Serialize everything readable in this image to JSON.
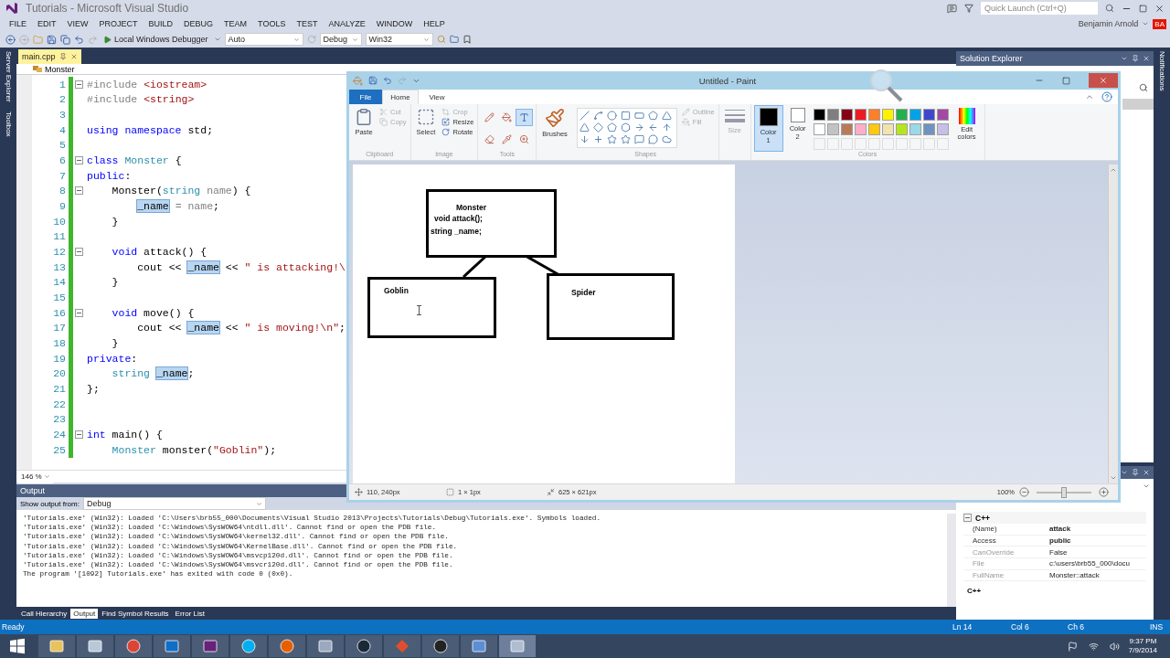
{
  "vs": {
    "title": "Tutorials - Microsoft Visual Studio",
    "quick_launch": {
      "placeholder": "Quick Launch (Ctrl+Q)"
    },
    "user": "Benjamin Arnold",
    "user_initials": "BA",
    "menu": [
      "FILE",
      "EDIT",
      "VIEW",
      "PROJECT",
      "BUILD",
      "DEBUG",
      "TEAM",
      "TOOLS",
      "TEST",
      "ANALYZE",
      "WINDOW",
      "HELP"
    ],
    "toolbar": {
      "debugger": "Local Windows Debugger",
      "target": "Auto",
      "configuration": "Debug",
      "platform": "Win32"
    },
    "side_tabs": [
      "Server Explorer",
      "Toolbox"
    ],
    "notifications_tab": "Notifications",
    "editor": {
      "tab": "main.cpp",
      "scope": "Monster",
      "zoom": "146 %",
      "lines": [
        {
          "number": "1",
          "fold": true,
          "tokens": [
            {
              "kind": "pre",
              "text": "#include "
            },
            {
              "kind": "str",
              "text": "<iostream>"
            }
          ]
        },
        {
          "number": "2",
          "fold": false,
          "tokens": [
            {
              "kind": "pre",
              "text": "#include "
            },
            {
              "kind": "str",
              "text": "<string>"
            }
          ]
        },
        {
          "number": "3",
          "fold": false
        },
        {
          "number": "4",
          "fold": false,
          "tokens": [
            {
              "kind": "kw",
              "text": "using namespace"
            },
            {
              "kind": "plain",
              "text": " std;"
            }
          ]
        },
        {
          "number": "5",
          "fold": false
        },
        {
          "number": "6",
          "fold": true,
          "tokens": [
            {
              "kind": "kw",
              "text": "class "
            },
            {
              "kind": "type",
              "text": "Monster"
            },
            {
              "kind": "plain",
              "text": " {"
            }
          ]
        },
        {
          "number": "7",
          "fold": false,
          "tokens": [
            {
              "kind": "kw",
              "text": "public"
            },
            {
              "kind": "plain",
              "text": ":"
            }
          ]
        },
        {
          "number": "8",
          "fold": true,
          "tokens": [
            {
              "kind": "plain",
              "text": "    Monster("
            },
            {
              "kind": "type",
              "text": "string"
            },
            {
              "kind": "param",
              "text": " name"
            },
            {
              "kind": "plain",
              "text": ") {"
            }
          ]
        },
        {
          "number": "9",
          "fold": false,
          "tokens": [
            {
              "kind": "ref",
              "text": "        _name"
            },
            {
              "kind": "param",
              "text": " = name"
            },
            {
              "kind": "plain",
              "text": ";"
            }
          ]
        },
        {
          "number": "10",
          "fold": false,
          "tokens": [
            {
              "kind": "plain",
              "text": "    }"
            }
          ]
        },
        {
          "number": "11",
          "fold": false
        },
        {
          "number": "12",
          "fold": true,
          "tokens": [
            {
              "kind": "kw",
              "text": "    void"
            },
            {
              "kind": "plain",
              "text": " attack() {"
            }
          ]
        },
        {
          "number": "13",
          "fold": false,
          "tokens": [
            {
              "kind": "plain",
              "text": "        cout << "
            },
            {
              "kind": "ref",
              "text": "_name"
            },
            {
              "kind": "plain",
              "text": " << "
            },
            {
              "kind": "str",
              "text": "\" is attacking!\\"
            }
          ]
        },
        {
          "number": "14",
          "fold": false,
          "tokens": [
            {
              "kind": "plain",
              "text": "    }"
            }
          ]
        },
        {
          "number": "15",
          "fold": false
        },
        {
          "number": "16",
          "fold": true,
          "tokens": [
            {
              "kind": "kw",
              "text": "    void"
            },
            {
              "kind": "plain",
              "text": " move() {"
            }
          ]
        },
        {
          "number": "17",
          "fold": false,
          "tokens": [
            {
              "kind": "plain",
              "text": "        cout << "
            },
            {
              "kind": "ref",
              "text": "_name"
            },
            {
              "kind": "plain",
              "text": " << "
            },
            {
              "kind": "str",
              "text": "\" is moving!\\n\""
            },
            {
              "kind": "plain",
              "text": ";"
            }
          ]
        },
        {
          "number": "18",
          "fold": false,
          "tokens": [
            {
              "kind": "plain",
              "text": "    }"
            }
          ]
        },
        {
          "number": "19",
          "fold": false,
          "tokens": [
            {
              "kind": "kw",
              "text": "private"
            },
            {
              "kind": "plain",
              "text": ":"
            }
          ]
        },
        {
          "number": "20",
          "fold": false,
          "tokens": [
            {
              "kind": "type",
              "text": "    string"
            },
            {
              "kind": "ref",
              "text": " _name"
            },
            {
              "kind": "plain",
              "text": ";"
            }
          ]
        },
        {
          "number": "21",
          "fold": false,
          "tokens": [
            {
              "kind": "plain",
              "text": "};"
            }
          ]
        },
        {
          "number": "22",
          "fold": false
        },
        {
          "number": "23",
          "fold": false
        },
        {
          "number": "24",
          "fold": true,
          "tokens": [
            {
              "kind": "kw",
              "text": "int"
            },
            {
              "kind": "plain",
              "text": " main() {"
            }
          ]
        },
        {
          "number": "25",
          "fold": false,
          "tokens": [
            {
              "kind": "type",
              "text": "    Monster"
            },
            {
              "kind": "plain",
              "text": " monster("
            },
            {
              "kind": "str",
              "text": "\"Goblin\""
            },
            {
              "kind": "plain",
              "text": ");"
            }
          ]
        }
      ]
    },
    "output": {
      "title": "Output",
      "source_label": "Show output from:",
      "source": "Debug",
      "lines": [
        "'Tutorials.exe' (Win32): Loaded 'C:\\Users\\brb55_000\\Documents\\Visual Studio 2013\\Projects\\Tutorials\\Debug\\Tutorials.exe'. Symbols loaded.",
        "'Tutorials.exe' (Win32): Loaded 'C:\\Windows\\SysWOW64\\ntdll.dll'. Cannot find or open the PDB file.",
        "'Tutorials.exe' (Win32): Loaded 'C:\\Windows\\SysWOW64\\kernel32.dll'. Cannot find or open the PDB file.",
        "'Tutorials.exe' (Win32): Loaded 'C:\\Windows\\SysWOW64\\KernelBase.dll'. Cannot find or open the PDB file.",
        "'Tutorials.exe' (Win32): Loaded 'C:\\Windows\\SysWOW64\\msvcp120d.dll'. Cannot find or open the PDB file.",
        "'Tutorials.exe' (Win32): Loaded 'C:\\Windows\\SysWOW64\\msvcr120d.dll'. Cannot find or open the PDB file.",
        "The program '[1092] Tutorials.exe' has exited with code 0 (0x0)."
      ]
    },
    "bottom_tabs": [
      {
        "label": "Call Hierarchy",
        "selected": false
      },
      {
        "label": "Output",
        "selected": true
      },
      {
        "label": "Find Symbol Results",
        "selected": false
      },
      {
        "label": "Error List",
        "selected": false
      }
    ],
    "solution_explorer": {
      "title": "Solution Explorer"
    },
    "properties": {
      "group": "C++",
      "rows": [
        {
          "name": "(Name)",
          "value": "attack",
          "readonly": false
        },
        {
          "name": "Access",
          "value": "public",
          "readonly": false
        },
        {
          "name": "CanOverride",
          "value": "False",
          "readonly": true
        },
        {
          "name": "File",
          "value": "c:\\users\\brb55_000\\docu",
          "readonly": true
        },
        {
          "name": "FullName",
          "value": "Monster::attack",
          "readonly": true
        }
      ],
      "description": "C++"
    },
    "status": {
      "text": "Ready",
      "line": "Ln 14",
      "column": "Col 6",
      "char": "Ch 6",
      "mode": "INS"
    }
  },
  "paint": {
    "title": "Untitled - Paint",
    "file_tab": "File",
    "tabs": [
      {
        "label": "Home",
        "selected": true
      },
      {
        "label": "View",
        "selected": false
      }
    ],
    "clipboard": {
      "paste": "Paste",
      "items": [
        {
          "label": "Cut",
          "disabled": true
        },
        {
          "label": "Copy",
          "disabled": true
        }
      ],
      "group": "Clipboard"
    },
    "image": {
      "select": "Select",
      "items": [
        {
          "label": "Crop",
          "disabled": true
        },
        {
          "label": "Resize",
          "disabled": false
        },
        {
          "label": "Rotate",
          "disabled": false
        }
      ],
      "group": "Image"
    },
    "tools": {
      "group": "Tools",
      "items": [
        {
          "selected": false
        },
        {
          "selected": false
        },
        {
          "selected": true
        },
        {
          "selected": false
        },
        {
          "selected": false
        },
        {
          "selected": false
        }
      ]
    },
    "brushes": "Brushes",
    "shapes": {
      "group": "Shapes",
      "items": [
        {
          "label": "Outline",
          "disabled": true
        },
        {
          "label": "Fill",
          "disabled": true
        }
      ]
    },
    "size": {
      "label": "Size",
      "disabled": true
    },
    "colors": {
      "group": "Colors",
      "slots": [
        {
          "label": "Color",
          "number": "1",
          "color": "#000000",
          "selected": true
        },
        {
          "label": "Color",
          "number": "2",
          "color": "#ffffff",
          "selected": false
        }
      ],
      "palette": [
        {
          "color": "#000000"
        },
        {
          "color": "#7f7f7f"
        },
        {
          "color": "#880015"
        },
        {
          "color": "#ed1c24"
        },
        {
          "color": "#ff7f27"
        },
        {
          "color": "#fff200"
        },
        {
          "color": "#22b14c"
        },
        {
          "color": "#00a2e8"
        },
        {
          "color": "#3f48cc"
        },
        {
          "color": "#a349a4"
        },
        {
          "color": "#ffffff"
        },
        {
          "color": "#c3c3c3"
        },
        {
          "color": "#b97a57"
        },
        {
          "color": "#ffaec9"
        },
        {
          "color": "#ffc90e"
        },
        {
          "color": "#efe4b0"
        },
        {
          "color": "#b5e61d"
        },
        {
          "color": "#99d9ea"
        },
        {
          "color": "#7092be"
        },
        {
          "color": "#c8bfe7"
        }
      ],
      "edit": "Edit colors"
    },
    "canvas": {
      "boxes": [
        {
          "lines": [
            "Monster",
            "void attack();",
            "string _name;"
          ]
        },
        {
          "lines": [
            "Goblin"
          ]
        },
        {
          "lines": [
            "Spider"
          ]
        }
      ]
    },
    "status": {
      "position": "110, 240px",
      "selection": "1 × 1px",
      "size": "625 × 621px",
      "zoom": "100%",
      "level": 0.5
    }
  },
  "taskbar": {
    "apps": [
      {
        "selected": false
      },
      {
        "selected": false
      },
      {
        "selected": false
      },
      {
        "selected": false
      },
      {
        "selected": false
      },
      {
        "selected": false
      },
      {
        "selected": false
      },
      {
        "selected": false
      },
      {
        "selected": false
      },
      {
        "selected": false
      },
      {
        "selected": false
      },
      {
        "selected": false
      },
      {
        "selected": true
      }
    ],
    "time": "9:37 PM",
    "date": "7/9/2014"
  }
}
